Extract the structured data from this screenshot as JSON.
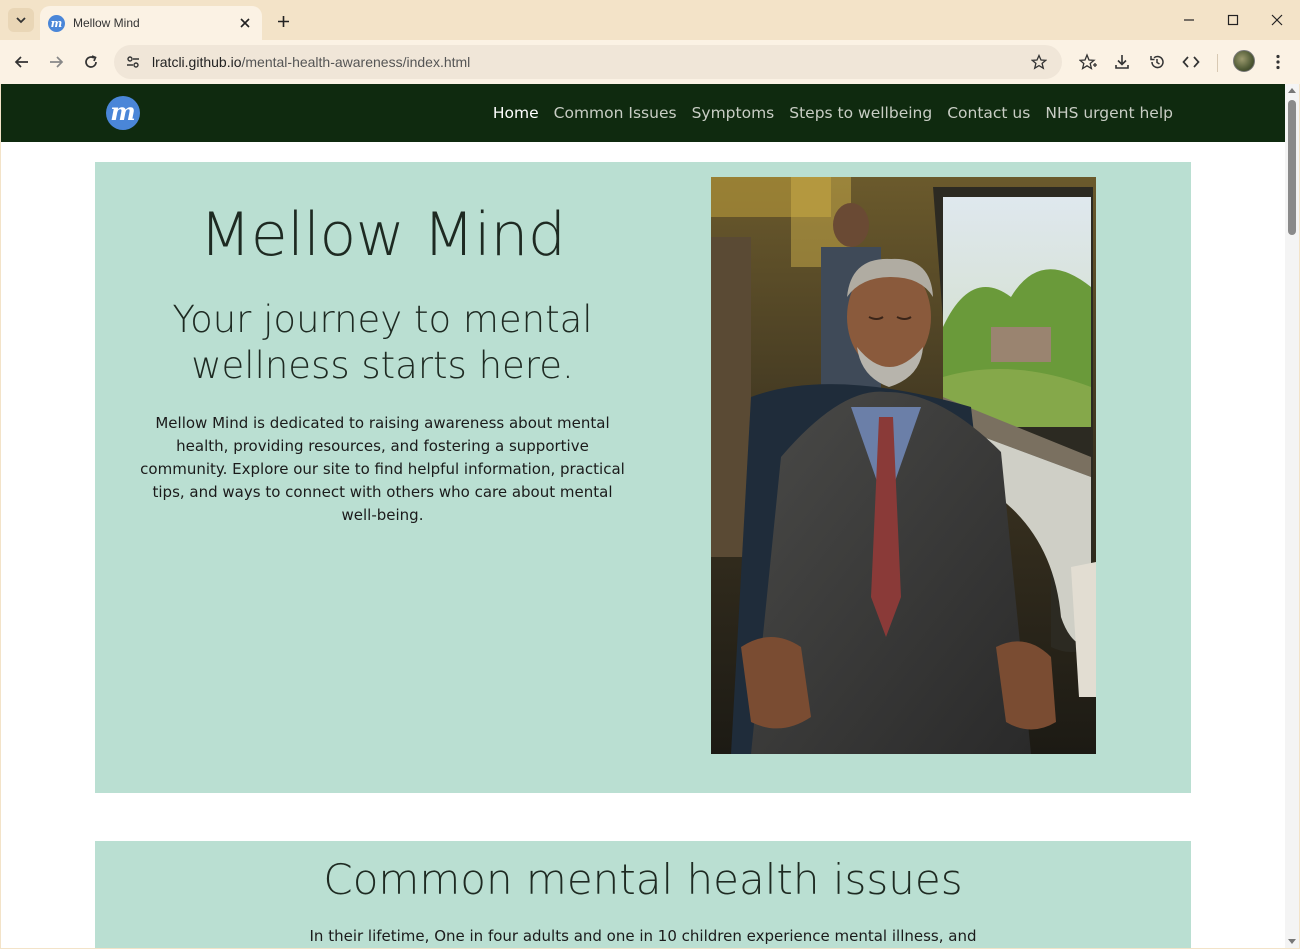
{
  "browser": {
    "tab_title": "Mellow Mind",
    "favicon_letter": "m",
    "url_host": "lratcli.github.io",
    "url_path": "/mental-health-awareness/index.html"
  },
  "site": {
    "logo_letter": "m",
    "nav": [
      {
        "label": "Home",
        "active": true
      },
      {
        "label": "Common Issues"
      },
      {
        "label": "Symptoms"
      },
      {
        "label": "Steps to wellbeing"
      },
      {
        "label": "Contact us"
      },
      {
        "label": "NHS urgent help"
      }
    ]
  },
  "hero": {
    "title": "Mellow Mind",
    "subtitle": "Your journey to mental wellness starts here.",
    "body": "Mellow Mind is dedicated to raising awareness about mental health, providing resources, and fostering a supportive community. Explore our site to find helpful information, practical tips, and ways to connect with others who care about mental well-being."
  },
  "common_issues": {
    "title": "Common mental health issues",
    "body": "In their lifetime, One in four adults and one in 10 children experience mental illness, and"
  },
  "colors": {
    "nav_bg": "#0f2a0f",
    "section_bg": "#badfd2",
    "chrome_bg": "#f3e3c8",
    "logo_blue": "#4a86d8"
  }
}
